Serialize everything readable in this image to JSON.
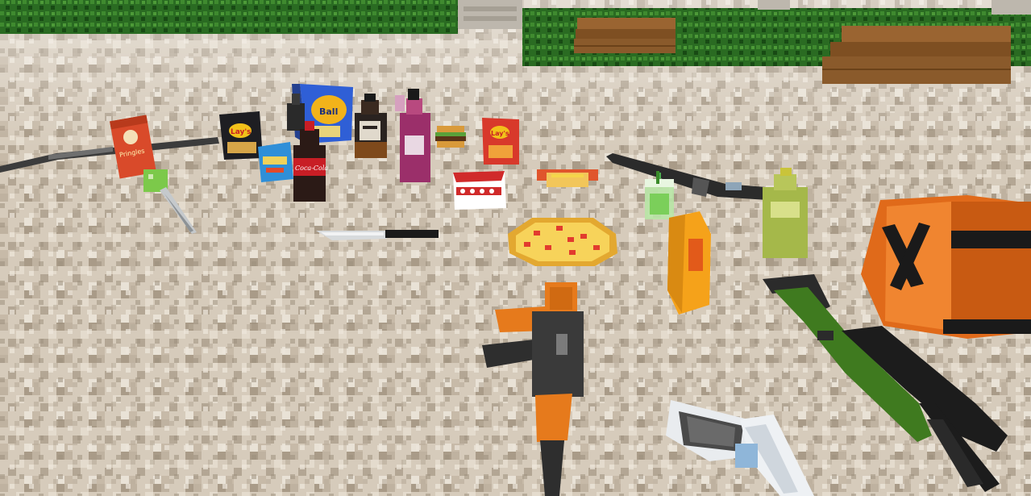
{
  "scene": {
    "description_free": true
  },
  "items": {
    "pringles": {
      "label": "Pringles"
    },
    "lays_black": {
      "label": "Lay's"
    },
    "cheese_balls": {
      "label": "Cheese Balls",
      "label_short": "Ball"
    },
    "coca_cola": {
      "label": "Coca-Cola"
    },
    "lays_red": {
      "label": "Lay's"
    }
  },
  "colors": {
    "ground_base": "#cfc4b4",
    "hedge": "#1f5a1a",
    "bench_wood": "#8a5a2b",
    "ak_orange": "#d9731a",
    "ak_metal": "#3a3a3a",
    "sniper_green": "#3f7a1f",
    "pizza_crust": "#f2c65a",
    "pizza_pepperoni": "#e23b2e",
    "lays_red": "#d8392b",
    "pringles_red": "#d94a2a",
    "coke_red": "#c81e25"
  }
}
